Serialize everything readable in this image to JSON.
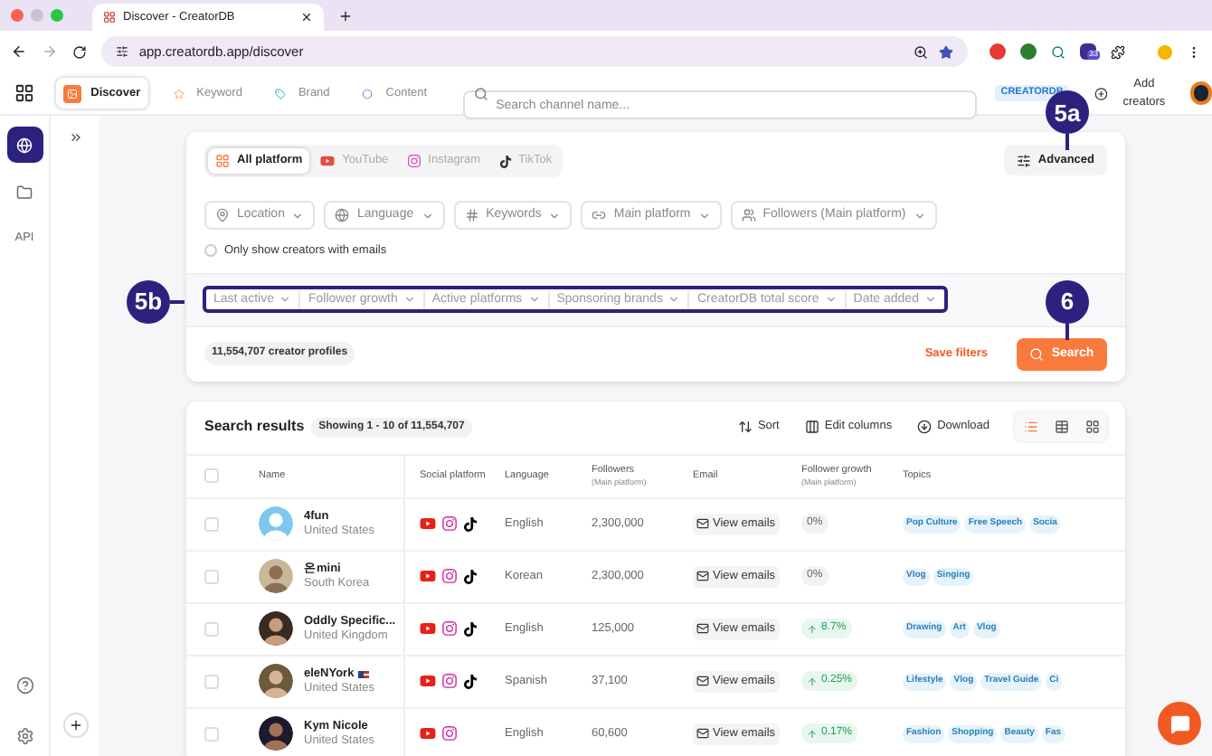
{
  "browser": {
    "tab_title": "Discover - CreatorDB",
    "url": "app.creatordb.app/discover",
    "extension_badge": "33"
  },
  "header": {
    "nav": [
      {
        "label": "Discover",
        "kind": "discover",
        "selected": true
      },
      {
        "label": "Keyword",
        "kind": "keyword",
        "selected": false
      },
      {
        "label": "Brand",
        "kind": "brand",
        "selected": false
      },
      {
        "label": "Content",
        "kind": "content",
        "selected": false
      }
    ],
    "search": {
      "placeholder": "Search channel name..."
    },
    "brand_badge": "CREATORDB",
    "add_button": "Add creators"
  },
  "sidebar": {
    "items": [
      {
        "kind": "globe",
        "selected": true
      },
      {
        "kind": "folder",
        "selected": false
      },
      {
        "kind": "text",
        "label": "API",
        "selected": false
      }
    ]
  },
  "filters": {
    "platform_tabs": [
      {
        "label": "All platform",
        "kind": "all",
        "selected": true
      },
      {
        "label": "YouTube",
        "kind": "youtube",
        "selected": false
      },
      {
        "label": "Instagram",
        "kind": "instagram",
        "selected": false
      },
      {
        "label": "TikTok",
        "kind": "tiktok",
        "selected": false
      }
    ],
    "advanced_button": "Advanced",
    "dropdowns": [
      {
        "label": "Location",
        "kind": "location"
      },
      {
        "label": "Language",
        "kind": "language"
      },
      {
        "label": "Keywords",
        "kind": "keywords"
      },
      {
        "label": "Main platform",
        "kind": "platform"
      },
      {
        "label": "Followers (Main platform)",
        "kind": "followers"
      }
    ],
    "email_only": {
      "label": "Only show creators with emails",
      "checked": false
    },
    "advanced_filters": [
      "Last active",
      "Follower growth",
      "Active platforms",
      "Sponsoring brands",
      "CreatorDB total score",
      "Date added"
    ],
    "profile_count": "11,554,707 creator profiles",
    "save_filters": "Save filters",
    "search_button": "Search"
  },
  "callouts": {
    "advanced": "5a",
    "advanced_filters": "5b",
    "search": "6"
  },
  "results": {
    "title": "Search results",
    "showing": "Showing 1 - 10 of 11,554,707",
    "actions": [
      {
        "label": "Sort",
        "kind": "sort"
      },
      {
        "label": "Edit columns",
        "kind": "columns"
      },
      {
        "label": "Download",
        "kind": "download"
      }
    ],
    "views": [
      {
        "kind": "list",
        "selected": true
      },
      {
        "kind": "table",
        "selected": false
      },
      {
        "kind": "grid",
        "selected": false
      }
    ],
    "select_all": {
      "checked": false
    },
    "columns": [
      {
        "label": "Name"
      },
      {
        "label": "Social platform"
      },
      {
        "label": "Language"
      },
      {
        "label": "Followers",
        "sub": "(Main platform)"
      },
      {
        "label": "Email"
      },
      {
        "label": "Follower growth",
        "sub": "(Main platform)"
      },
      {
        "label": "Topics"
      }
    ],
    "rows": [
      {
        "checked": false,
        "name": "4fun",
        "country": "United States",
        "flag": false,
        "platforms": [
          {
            "kind": "youtube"
          },
          {
            "kind": "instagram"
          },
          {
            "kind": "tiktok"
          }
        ],
        "language": "English",
        "followers": "2,300,000",
        "email": "View emails",
        "growth": {
          "kind": "flat",
          "value": "0%"
        },
        "topics": [
          "Pop Culture",
          "Free Speech",
          "Socia"
        ]
      },
      {
        "checked": false,
        "name": "온mini",
        "country": "South Korea",
        "flag": false,
        "platforms": [
          {
            "kind": "youtube"
          },
          {
            "kind": "instagram"
          },
          {
            "kind": "tiktok"
          }
        ],
        "language": "Korean",
        "followers": "2,300,000",
        "email": "View emails",
        "growth": {
          "kind": "flat",
          "value": "0%"
        },
        "topics": [
          "Vlog",
          "Singing"
        ]
      },
      {
        "checked": false,
        "name": "Oddly Specific...",
        "country": "United Kingdom",
        "flag": false,
        "platforms": [
          {
            "kind": "youtube"
          },
          {
            "kind": "instagram"
          },
          {
            "kind": "tiktok"
          }
        ],
        "language": "English",
        "followers": "125,000",
        "email": "View emails",
        "growth": {
          "kind": "up",
          "value": "8.7%"
        },
        "topics": [
          "Drawing",
          "Art",
          "Vlog"
        ]
      },
      {
        "checked": false,
        "name": "eleNYork",
        "country": "United States",
        "flag": true,
        "platforms": [
          {
            "kind": "youtube"
          },
          {
            "kind": "instagram"
          },
          {
            "kind": "tiktok"
          }
        ],
        "language": "Spanish",
        "followers": "37,100",
        "email": "View emails",
        "growth": {
          "kind": "up",
          "value": "0.25%"
        },
        "topics": [
          "Lifestyle",
          "Vlog",
          "Travel Guide",
          "Ci"
        ]
      },
      {
        "checked": false,
        "name": "Kym Nicole",
        "country": "United States",
        "flag": false,
        "platforms": [
          {
            "kind": "youtube"
          },
          {
            "kind": "instagram"
          }
        ],
        "language": "English",
        "followers": "60,600",
        "email": "View emails",
        "growth": {
          "kind": "up",
          "value": "0.17%"
        },
        "topics": [
          "Fashion",
          "Shopping",
          "Beauty",
          "Fas"
        ]
      }
    ]
  }
}
